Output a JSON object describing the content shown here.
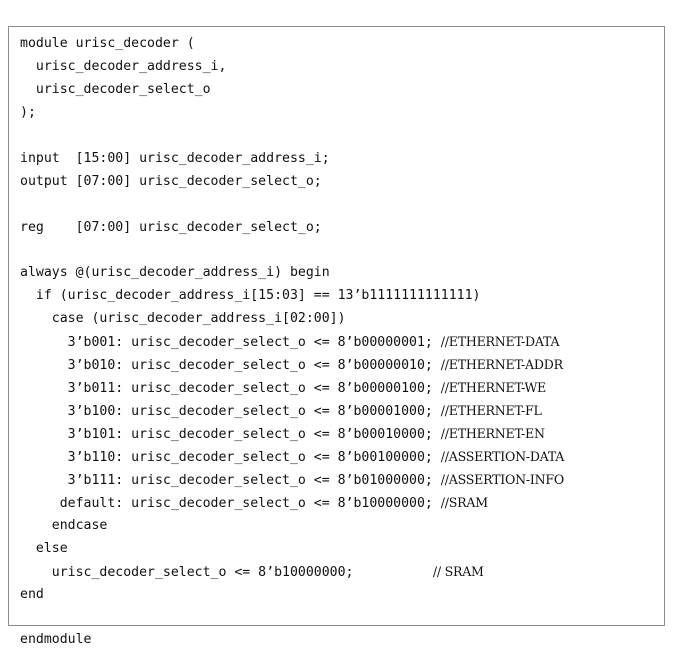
{
  "listing": {
    "language": "verilog",
    "module_name": "urisc_decoder",
    "border_color": "#8c8c8c",
    "background_color": "#ffffff",
    "text_color": "#111111",
    "lines": [
      {
        "code": "module urisc_decoder (",
        "comment": ""
      },
      {
        "code": "  urisc_decoder_address_i,",
        "comment": ""
      },
      {
        "code": "  urisc_decoder_select_o",
        "comment": ""
      },
      {
        "code": ");",
        "comment": ""
      },
      {
        "code": "",
        "comment": ""
      },
      {
        "code": "input  [15:00] urisc_decoder_address_i;",
        "comment": ""
      },
      {
        "code": "output [07:00] urisc_decoder_select_o;",
        "comment": ""
      },
      {
        "code": "",
        "comment": ""
      },
      {
        "code": "reg    [07:00] urisc_decoder_select_o;",
        "comment": ""
      },
      {
        "code": "",
        "comment": ""
      },
      {
        "code": "always @(urisc_decoder_address_i) begin",
        "comment": ""
      },
      {
        "code": "  if (urisc_decoder_address_i[15:03] == 13’b1111111111111)",
        "comment": ""
      },
      {
        "code": "    case (urisc_decoder_address_i[02:00])",
        "comment": ""
      },
      {
        "code": "      3’b001: urisc_decoder_select_o <= 8’b00000001; ",
        "comment": "//ETHERNET-DATA"
      },
      {
        "code": "      3’b010: urisc_decoder_select_o <= 8’b00000010; ",
        "comment": "//ETHERNET-ADDR"
      },
      {
        "code": "      3’b011: urisc_decoder_select_o <= 8’b00000100; ",
        "comment": "//ETHERNET-WE"
      },
      {
        "code": "      3’b100: urisc_decoder_select_o <= 8’b00001000; ",
        "comment": "//ETHERNET-FL"
      },
      {
        "code": "      3’b101: urisc_decoder_select_o <= 8’b00010000; ",
        "comment": "//ETHERNET-EN"
      },
      {
        "code": "      3’b110: urisc_decoder_select_o <= 8’b00100000; ",
        "comment": "//ASSERTION-DATA"
      },
      {
        "code": "      3’b111: urisc_decoder_select_o <= 8’b01000000; ",
        "comment": "//ASSERTION-INFO"
      },
      {
        "code": "     default: urisc_decoder_select_o <= 8’b10000000; ",
        "comment": "//SRAM"
      },
      {
        "code": "    endcase",
        "comment": ""
      },
      {
        "code": "  else",
        "comment": ""
      },
      {
        "code": "    urisc_decoder_select_o <= 8’b10000000;          ",
        "comment": "// SRAM"
      },
      {
        "code": "end",
        "comment": ""
      },
      {
        "code": "",
        "comment": ""
      },
      {
        "code": "endmodule",
        "comment": ""
      }
    ]
  }
}
